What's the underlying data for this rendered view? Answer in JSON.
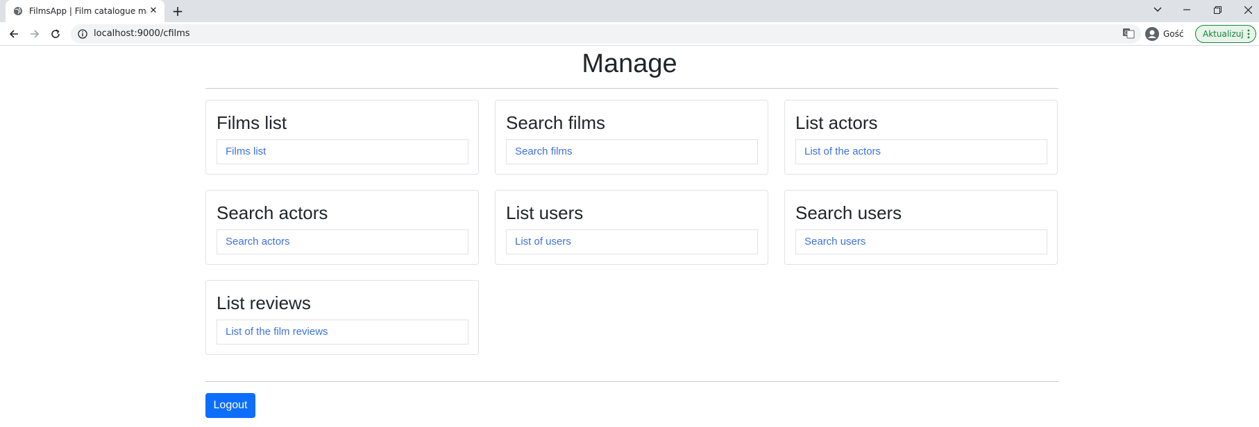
{
  "browser": {
    "tab_title": "FilmsApp | Film catalogue manag",
    "url": "localhost:9000/cfilms",
    "profile_label": "Gość",
    "update_label": "Aktualizuj"
  },
  "page": {
    "title": "Manage",
    "cards": [
      {
        "title": "Films list",
        "link": "Films list"
      },
      {
        "title": "Search films",
        "link": "Search films"
      },
      {
        "title": "List actors",
        "link": "List of the actors"
      },
      {
        "title": "Search actors",
        "link": "Search actors"
      },
      {
        "title": "List users",
        "link": "List of users"
      },
      {
        "title": "Search users",
        "link": "Search users"
      },
      {
        "title": "List reviews",
        "link": "List of the film reviews"
      }
    ],
    "logout_label": "Logout"
  },
  "colors": {
    "primary": "#0d6efd",
    "link": "#3d71e0",
    "update_green": "#188038"
  }
}
